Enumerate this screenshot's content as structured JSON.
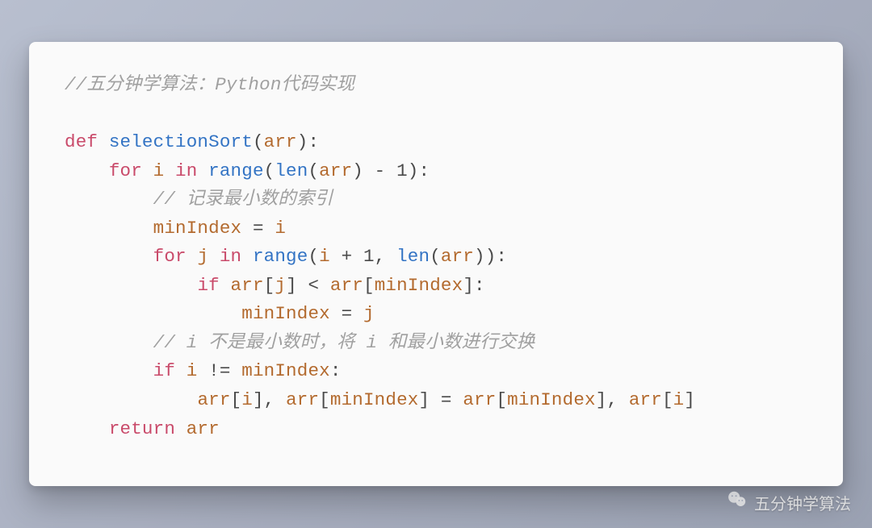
{
  "code": {
    "comment_title": "//五分钟学算法：Python代码实现",
    "kw_def": "def",
    "fn_name": "selectionSort",
    "param_arr": "arr",
    "kw_for": "for",
    "var_i": "i",
    "kw_in": "in",
    "fn_range": "range",
    "fn_len": "len",
    "minus": " - ",
    "one": "1",
    "comment_min": "// 记录最小数的索引",
    "var_minIndex": "minIndex",
    "eq": " = ",
    "var_j": "j",
    "plus": " + ",
    "comma_sp": ", ",
    "kw_if": "if",
    "lt": " < ",
    "comment_swap": "// i 不是最小数时，将 i 和最小数进行交换",
    "neq": " != ",
    "kw_return": "return"
  },
  "watermark": {
    "text": "五分钟学算法"
  }
}
